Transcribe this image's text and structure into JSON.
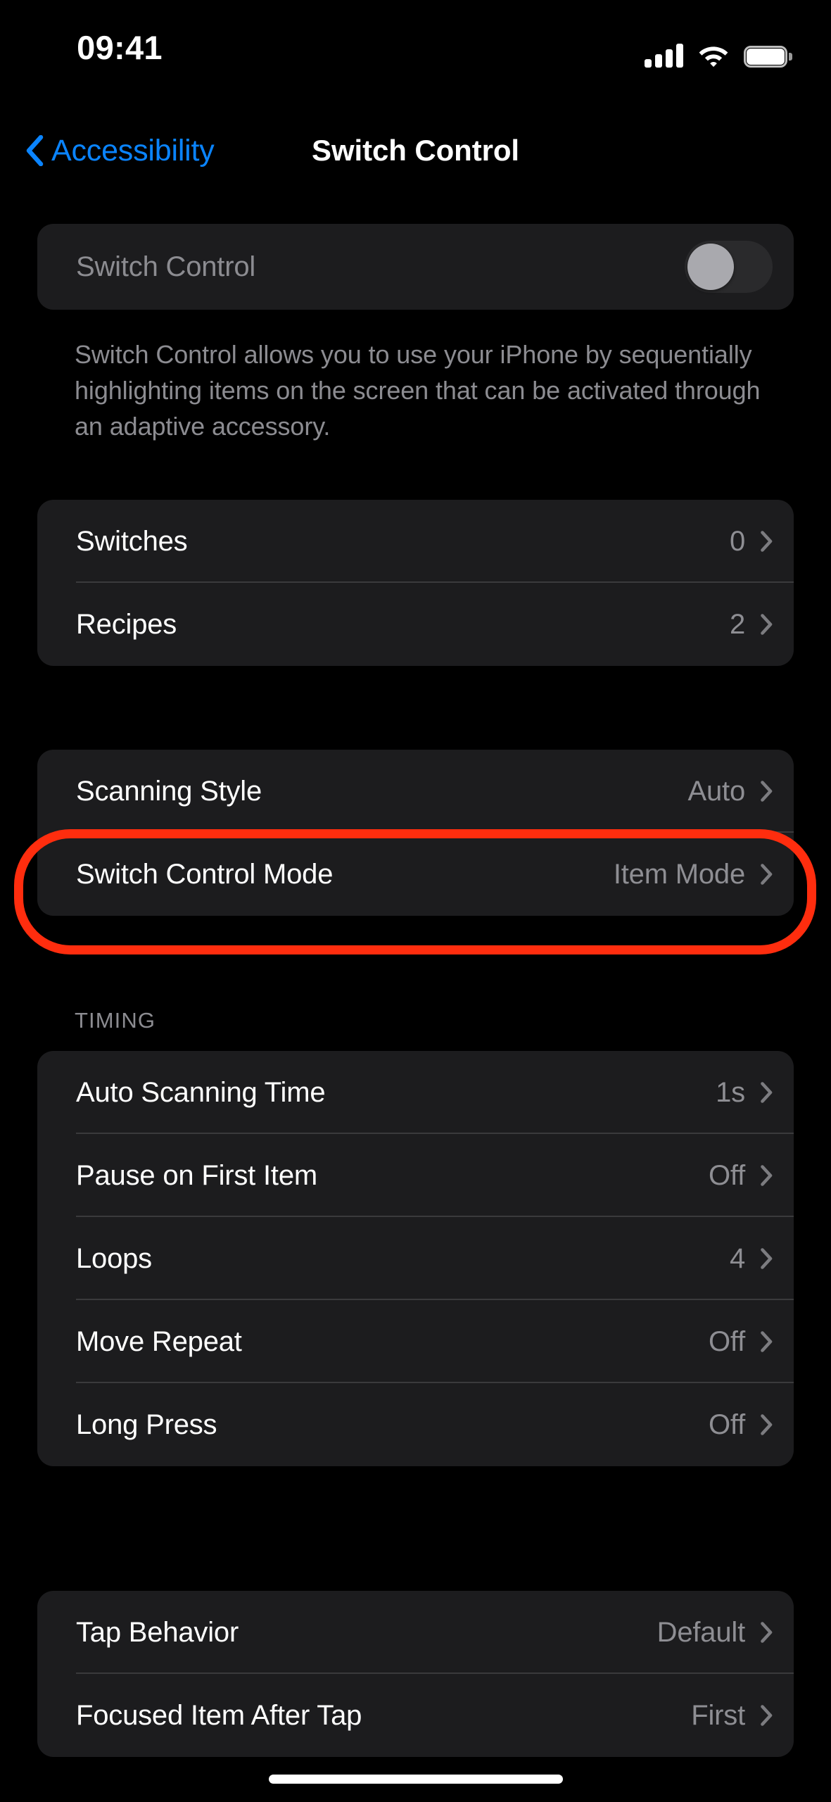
{
  "status_bar": {
    "time": "09:41",
    "cellular_icon": "cellular-bars-icon",
    "wifi_icon": "wifi-icon",
    "battery_icon": "battery-full-icon"
  },
  "nav": {
    "back_icon": "chevron-left-icon",
    "back_label": "Accessibility",
    "title": "Switch Control"
  },
  "toggle_section": {
    "label": "Switch Control",
    "toggle_state": "off",
    "footnote": "Switch Control allows you to use your iPhone by sequentially highlighting items on the screen that can be activated through an adaptive accessory."
  },
  "groups": [
    {
      "header": "",
      "rows": [
        {
          "label": "Switches",
          "value": "0",
          "chevron": "chevron-right-icon"
        },
        {
          "label": "Recipes",
          "value": "2",
          "chevron": "chevron-right-icon"
        }
      ]
    },
    {
      "header": "",
      "rows": [
        {
          "label": "Scanning Style",
          "value": "Auto",
          "chevron": "chevron-right-icon"
        },
        {
          "label": "Switch Control Mode",
          "value": "Item Mode",
          "chevron": "chevron-right-icon"
        }
      ]
    },
    {
      "header": "TIMING",
      "rows": [
        {
          "label": "Auto Scanning Time",
          "value": "1s",
          "chevron": "chevron-right-icon"
        },
        {
          "label": "Pause on First Item",
          "value": "Off",
          "chevron": "chevron-right-icon"
        },
        {
          "label": "Loops",
          "value": "4",
          "chevron": "chevron-right-icon"
        },
        {
          "label": "Move Repeat",
          "value": "Off",
          "chevron": "chevron-right-icon"
        },
        {
          "label": "Long Press",
          "value": "Off",
          "chevron": "chevron-right-icon"
        }
      ]
    },
    {
      "header": "",
      "rows": [
        {
          "label": "Tap Behavior",
          "value": "Default",
          "chevron": "chevron-right-icon"
        },
        {
          "label": "Focused Item After Tap",
          "value": "First",
          "chevron": "chevron-right-icon"
        }
      ]
    }
  ],
  "annotation": {
    "target_row_label": "Switch Control Mode",
    "color": "#FF2D0E",
    "shape": "rounded-rectangle-outline"
  },
  "colors": {
    "background": "#000000",
    "card": "#1C1C1E",
    "primary_text": "#FFFFFF",
    "secondary_text": "#8E8E93",
    "accent_blue": "#0A84FF",
    "separator": "#3A3A3C",
    "annotation_red": "#FF2D0E"
  },
  "home_indicator": "home-indicator"
}
